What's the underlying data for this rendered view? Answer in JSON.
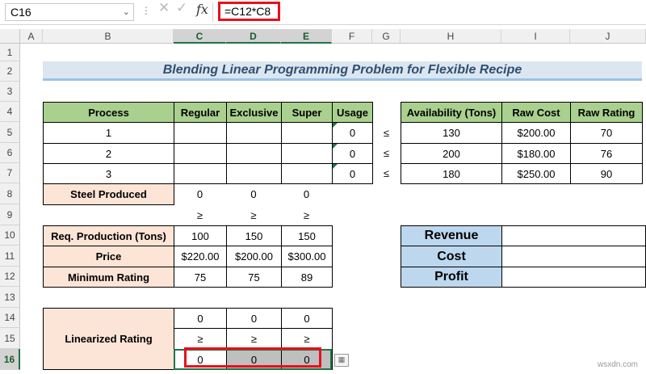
{
  "formula_bar": {
    "name_box": "C16",
    "cancel_icon": "✕",
    "enter_icon": "✓",
    "fx_label": "fx",
    "formula": "=C12*C8"
  },
  "columns": [
    "A",
    "B",
    "C",
    "D",
    "E",
    "F",
    "G",
    "H",
    "I",
    "J"
  ],
  "rows": [
    "1",
    "2",
    "3",
    "4",
    "5",
    "6",
    "7",
    "8",
    "9",
    "10",
    "11",
    "12",
    "13",
    "14",
    "15",
    "16"
  ],
  "title": "Blending Linear Programming Problem for Flexible Recipe",
  "process_table": {
    "headers": [
      "Process",
      "Regular",
      "Exclusive",
      "Super",
      "Usage"
    ],
    "rows": [
      {
        "process": "1",
        "usage": "0"
      },
      {
        "process": "2",
        "usage": "0"
      },
      {
        "process": "3",
        "usage": "0"
      }
    ],
    "leq": "≤"
  },
  "raw_table": {
    "headers": [
      "Availability (Tons)",
      "Raw Cost",
      "Raw Rating"
    ],
    "rows": [
      [
        "130",
        "$200.00",
        "70"
      ],
      [
        "200",
        "$180.00",
        "76"
      ],
      [
        "180",
        "$250.00",
        "90"
      ]
    ]
  },
  "steel": {
    "label": "Steel Produced",
    "values": [
      "0",
      "0",
      "0"
    ]
  },
  "geq": "≥",
  "requirements": [
    {
      "label": "Req. Production (Tons)",
      "values": [
        "100",
        "150",
        "150"
      ]
    },
    {
      "label": "Price",
      "values": [
        "$220.00",
        "$200.00",
        "$300.00"
      ]
    },
    {
      "label": "Minimum Rating",
      "values": [
        "75",
        "75",
        "89"
      ]
    }
  ],
  "summary": {
    "labels": [
      "Revenue",
      "Cost",
      "Profit"
    ]
  },
  "linearized": {
    "label": "Linearized Rating",
    "row14": [
      "0",
      "0",
      "0"
    ],
    "row16": [
      "0",
      "0",
      "0"
    ]
  },
  "watermark": "wsxdn.com",
  "colors": {
    "accent": "#217346",
    "highlight": "#e8101a",
    "header_green": "#a9d08e",
    "peach": "#fce4d6",
    "blue": "#bdd7ee"
  }
}
